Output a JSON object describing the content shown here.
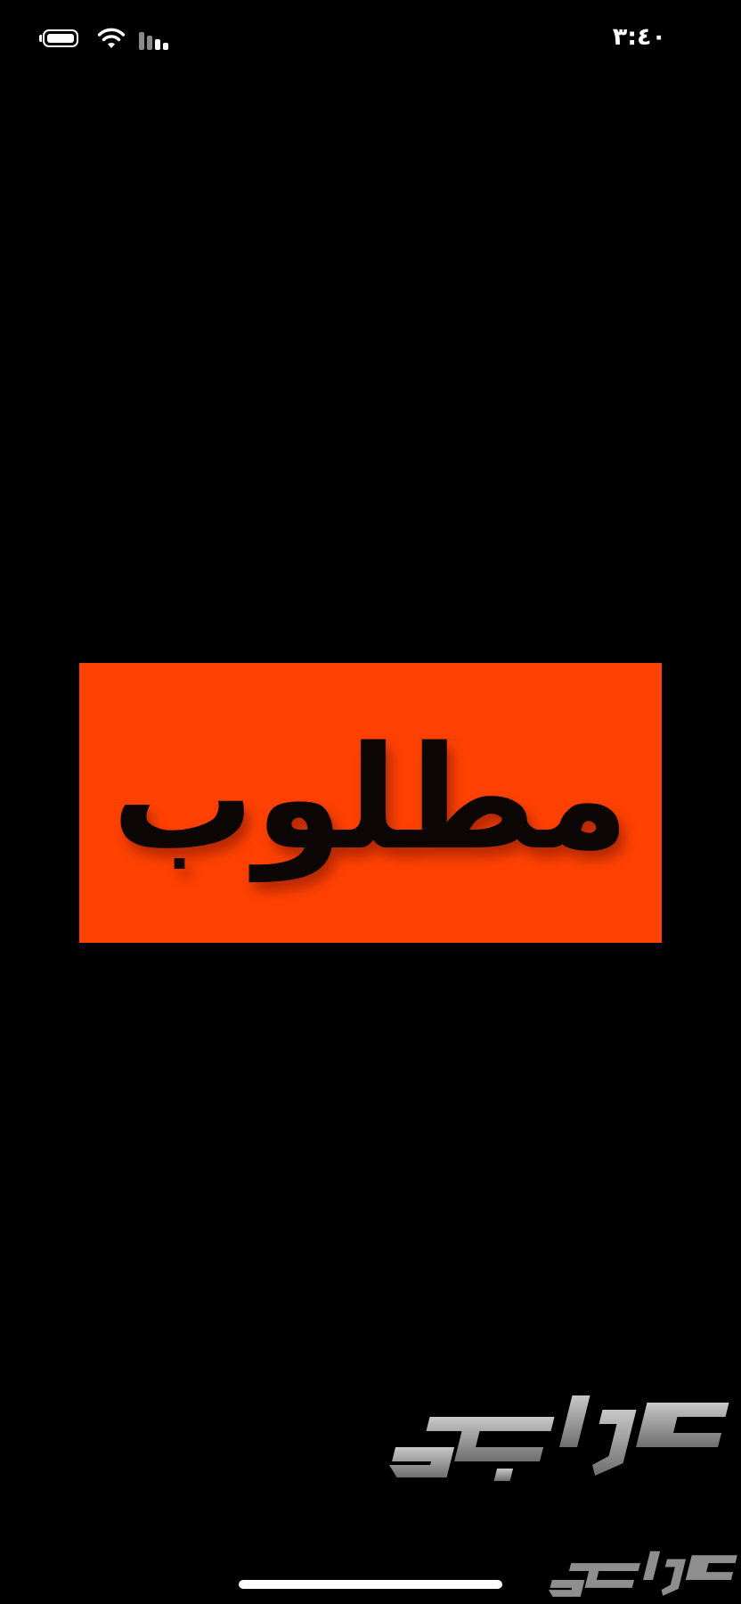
{
  "status_bar": {
    "time": "٣:٤٠",
    "battery_icon": "battery-icon",
    "wifi_icon": "wifi-icon",
    "signal_icon": "cellular-signal-icon"
  },
  "banner": {
    "text": "مطلوب",
    "background_color": "#ff4203",
    "text_color": "#0b0604"
  },
  "watermark": {
    "text": "حراج",
    "color": "#9a9a9a"
  }
}
